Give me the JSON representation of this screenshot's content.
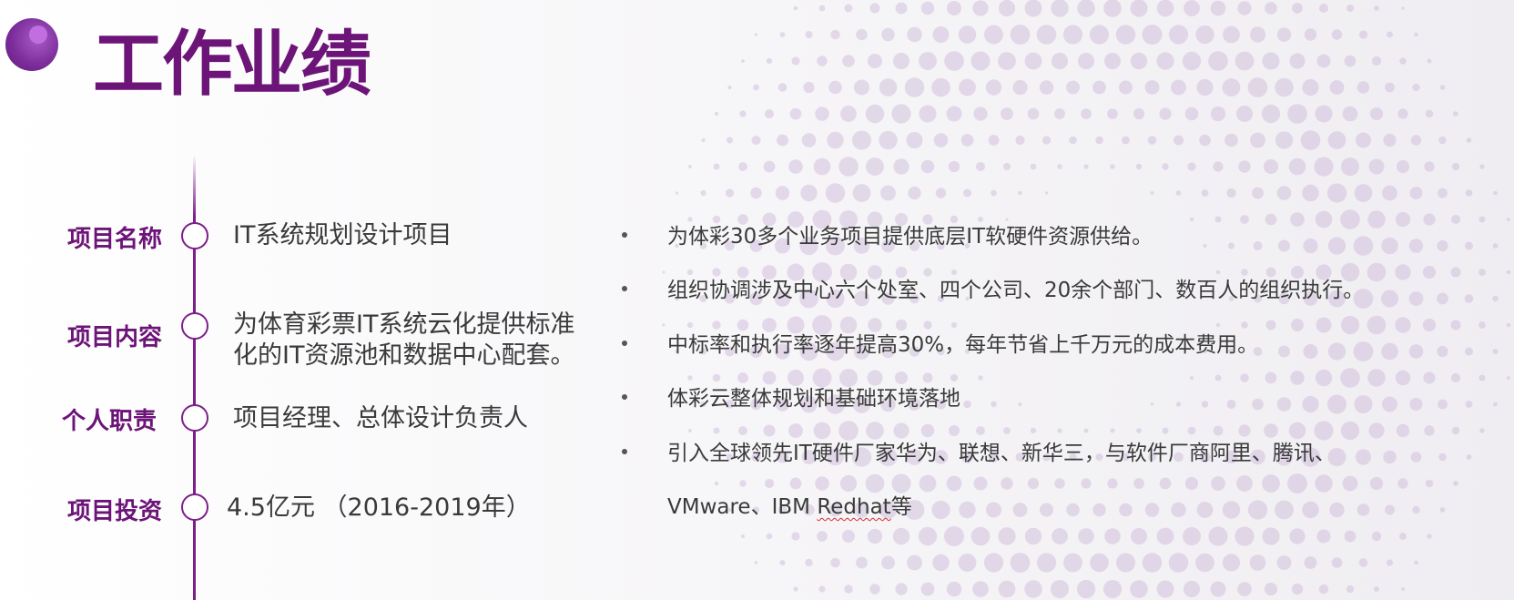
{
  "slide": {
    "title": "工作业绩",
    "accent_color": "#6c1478",
    "line_color": "#7d1f8a"
  },
  "timeline": [
    {
      "label": "项目名称",
      "value": "IT系统规划设计项目"
    },
    {
      "label": "项目内容",
      "value_lines": [
        "为体育彩票IT系统云化提供标准",
        "化的IT资源池和数据中心配套。"
      ]
    },
    {
      "label": "个人职责",
      "value": "项目经理、总体设计负责人"
    },
    {
      "label": "项目投资",
      "value": "4.5亿元 （2016-2019年）"
    }
  ],
  "bullets": [
    "为体彩30多个业务项目提供底层IT软硬件资源供给。",
    "组织协调涉及中心六个处室、四个公司、20余个部门、数百人的组织执行。",
    "中标率和执行率逐年提高30%，每年节省上千万元的成本费用。",
    "体彩云整体规划和基础环境落地"
  ],
  "last_bullet": {
    "line1": "引入全球领先IT硬件厂家华为、联想、新华三，与软件厂商阿里、腾讯、",
    "line2_prefix": "VMware、IBM ",
    "line2_underlined": "Redhat",
    "line2_suffix": "等"
  }
}
